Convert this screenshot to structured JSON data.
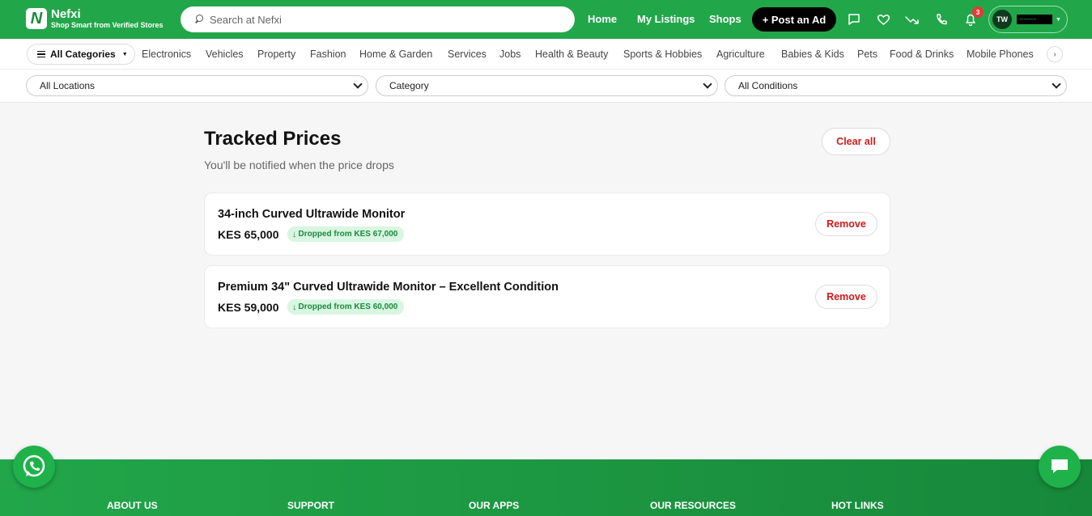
{
  "header": {
    "brand_name": "Nefxi",
    "brand_tagline": "Shop Smart from Verified Stores",
    "search_placeholder": "Search at Nefxi",
    "nav": {
      "home": "Home",
      "my_listings": "My Listings",
      "shops": "Shops"
    },
    "post_ad_label": "+ Post an Ad",
    "notification_count": "3",
    "user_initials": "TW",
    "user_name": "--------",
    "icons": [
      "chat-icon",
      "heart-icon",
      "trend-icon",
      "phone-icon",
      "bell-icon"
    ]
  },
  "categories": {
    "all_label": "All Categories",
    "items": [
      "Electronics",
      "Vehicles",
      "Property",
      "Fashion",
      "Home & Garden",
      "Services",
      "Jobs",
      "Health & Beauty",
      "Sports & Hobbies",
      "Agriculture",
      "Babies & Kids",
      "Pets",
      "Food & Drinks",
      "Mobile Phones"
    ]
  },
  "filters": {
    "location": "All Locations",
    "category": "Category",
    "condition": "All Conditions"
  },
  "main": {
    "title": "Tracked Prices",
    "subtitle": "You'll be notified when the price drops",
    "clear_all_label": "Clear all",
    "items": [
      {
        "title": "34-inch Curved Ultrawide Monitor",
        "price": "KES 65,000",
        "drop_label": "Dropped from KES 67,000",
        "remove_label": "Remove"
      },
      {
        "title": "Premium 34\" Curved Ultrawide Monitor – Excellent Condition",
        "price": "KES 59,000",
        "drop_label": "Dropped from KES 60,000",
        "remove_label": "Remove"
      }
    ]
  },
  "footer": {
    "headings": [
      "ABOUT US",
      "SUPPORT",
      "OUR APPS",
      "OUR RESOURCES",
      "HOT LINKS"
    ]
  },
  "colors": {
    "brand_green": "#22a64a",
    "danger_red": "#d11a1a",
    "drop_badge_bg": "#d9f6e2"
  }
}
